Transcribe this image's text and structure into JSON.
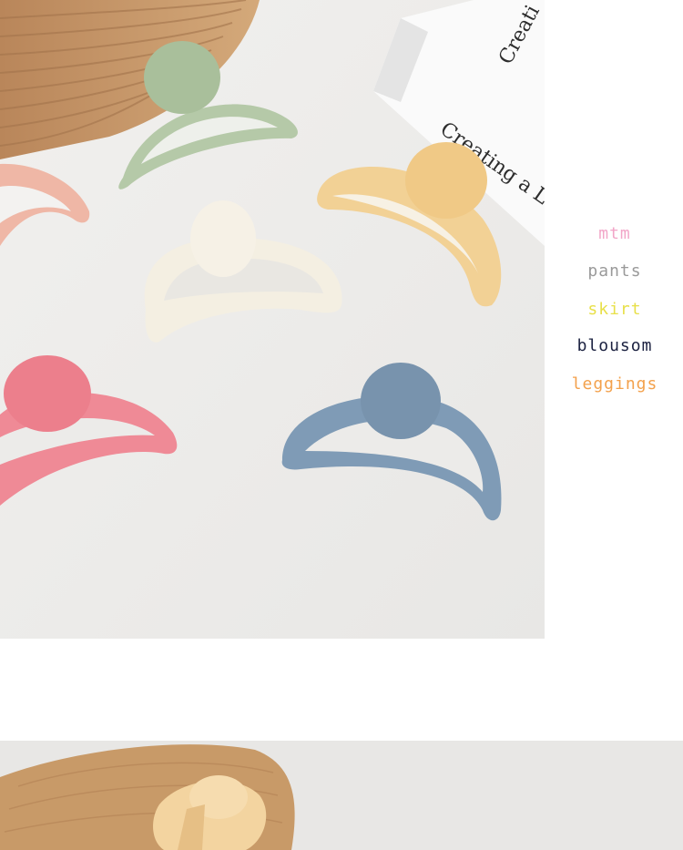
{
  "side_labels": {
    "item1": "mtm",
    "item2": "pants",
    "item3": "skirt",
    "item4": "blousom",
    "item5": "leggings"
  },
  "book": {
    "spine_text": "Creati",
    "cover_text": "Creating a L"
  },
  "colors": {
    "background": "#ffffff",
    "photo_bg": "#ededeb",
    "wood": "#c89a68",
    "clip_green": "#b5c9a8",
    "clip_peach": "#efb7a6",
    "clip_cream": "#f4efe2",
    "clip_yellow": "#f2d195",
    "clip_pink": "#ef8a96",
    "clip_blue": "#7f9bb6",
    "label_mtm": "#f2a6c8",
    "label_pants": "#9a9a9a",
    "label_skirt": "#e8e04a",
    "label_blousom": "#1b2140",
    "label_leggings": "#f3a14c"
  }
}
